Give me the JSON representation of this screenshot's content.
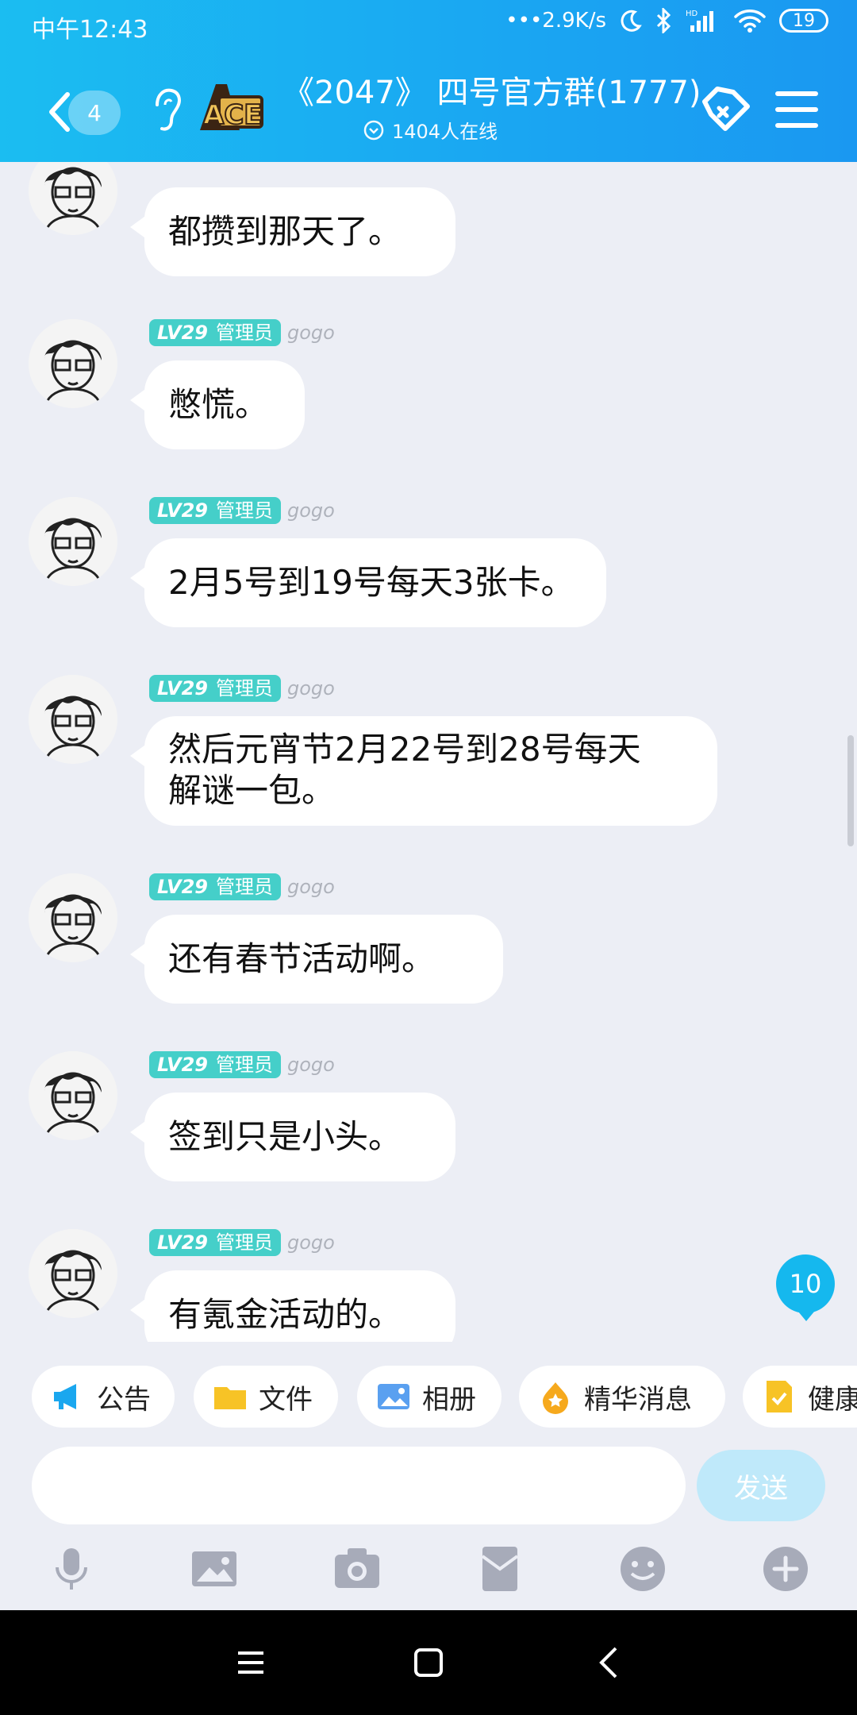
{
  "status_bar": {
    "time": "中午12:43",
    "net_speed": "•••2.9K/s",
    "battery": "19"
  },
  "header": {
    "back_badge": "4",
    "title": "《2047》 四号官方群(1777)",
    "online": "1404人在线"
  },
  "messages": [
    {
      "text": "都攒到那天了。",
      "badge": null
    },
    {
      "level": "LV29",
      "role": "管理员",
      "nick": "gogo",
      "text": "憋慌。"
    },
    {
      "level": "LV29",
      "role": "管理员",
      "nick": "gogo",
      "text": "2月5号到19号每天3张卡。"
    },
    {
      "level": "LV29",
      "role": "管理员",
      "nick": "gogo",
      "text": "然后元宵节2月22号到28号每天\n解谜一包。"
    },
    {
      "level": "LV29",
      "role": "管理员",
      "nick": "gogo",
      "text": "还有春节活动啊。"
    },
    {
      "level": "LV29",
      "role": "管理员",
      "nick": "gogo",
      "text": "签到只是小头。"
    },
    {
      "level": "LV29",
      "role": "管理员",
      "nick": "gogo",
      "text": "有氪金活动的。"
    }
  ],
  "new_messages_count": "10",
  "quick_actions": [
    "公告",
    "文件",
    "相册",
    "精华消息",
    "健康"
  ],
  "input": {
    "placeholder": "",
    "send_label": "发送"
  },
  "colors": {
    "header": "#1bbdf1",
    "badge": "#45cfc9",
    "send_disabled": "#bfe9fa"
  }
}
